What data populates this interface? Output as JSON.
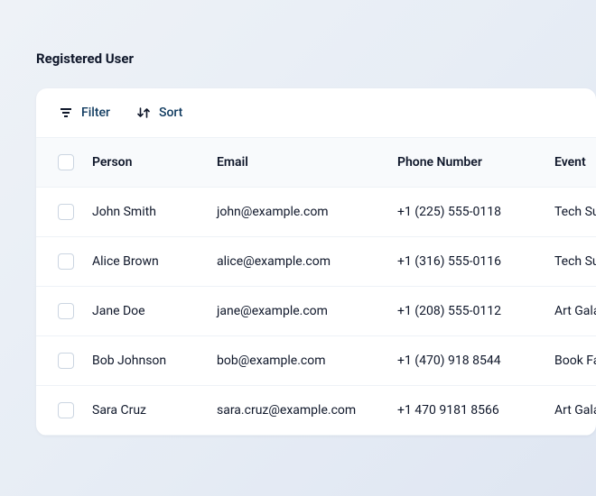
{
  "title": "Registered User",
  "toolbar": {
    "filter_label": "Filter",
    "sort_label": "Sort"
  },
  "table": {
    "headers": {
      "person": "Person",
      "email": "Email",
      "phone": "Phone Number",
      "event": "Event"
    },
    "rows": [
      {
        "person": "John Smith",
        "email": "john@example.com",
        "phone": "+1 (225) 555-0118",
        "event": "Tech Sur"
      },
      {
        "person": "Alice Brown",
        "email": "alice@example.com",
        "phone": "+1 (316) 555-0116",
        "event": "Tech Sur"
      },
      {
        "person": "Jane Doe",
        "email": "jane@example.com",
        "phone": "+1 (208) 555-0112",
        "event": "Art Gala"
      },
      {
        "person": "Bob Johnson",
        "email": "bob@example.com",
        "phone": "+1 (470) 918 8544",
        "event": "Book Fai"
      },
      {
        "person": "Sara Cruz",
        "email": "sara.cruz@example.com",
        "phone": "+1 470 9181 8566",
        "event": "Art Gala"
      }
    ]
  }
}
